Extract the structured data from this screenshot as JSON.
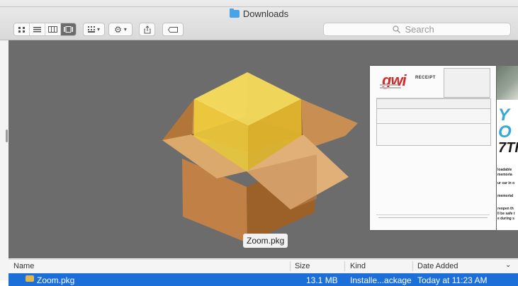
{
  "window": {
    "title": "Downloads"
  },
  "toolbar": {
    "search_placeholder": "Search",
    "view_modes": [
      "icon-view",
      "list-view",
      "column-view",
      "gallery-view"
    ],
    "active_view": "gallery-view"
  },
  "preview": {
    "file_caption": "Zoom.pkg",
    "receipt": {
      "brand": "gwi",
      "label": "RECEIPT"
    },
    "banner_fragments": [
      "Y",
      "O",
      "7TI",
      "loadable",
      "memoria",
      "ur car in o",
      "memorial",
      "reopen th",
      "ll be safe t",
      "e during s"
    ]
  },
  "list": {
    "columns": [
      "Name",
      "Size",
      "Kind",
      "Date Added"
    ],
    "rows": [
      {
        "name": "Zoom.pkg",
        "size": "13.1 MB",
        "kind": "Installe...ackage",
        "date_added": "Today at 11:23 AM",
        "selected": true
      }
    ]
  },
  "colors": {
    "selection": "#1c6fd8",
    "preview_bg": "#6c6c6c",
    "folder": "#4aa3e6"
  }
}
